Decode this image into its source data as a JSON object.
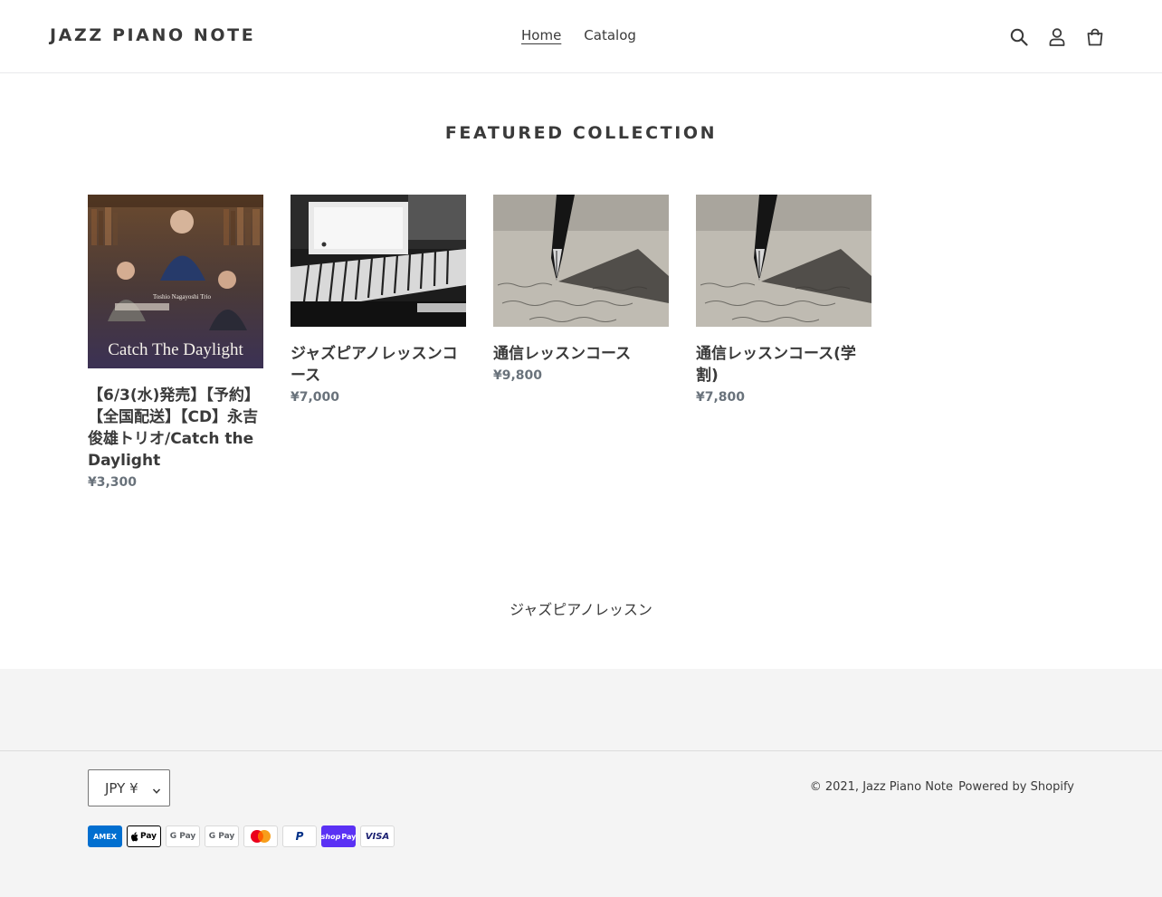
{
  "header": {
    "logo": "JAZZ PIANO NOTE",
    "nav": [
      {
        "label": "Home",
        "active": true
      },
      {
        "label": "Catalog",
        "active": false
      }
    ],
    "icons": [
      "search-icon",
      "account-icon",
      "cart-icon"
    ]
  },
  "featured": {
    "title": "FEATURED COLLECTION",
    "products": [
      {
        "title": "【6/3(水)発売】【予約】【全国配送】【CD】永吉俊雄トリオ/Catch the Daylight",
        "price": "¥3,300",
        "image_caption": "Catch The Daylight",
        "image_subcaption": "Toshio Nagayoshi Trio"
      },
      {
        "title": "ジャズピアノレッスンコース",
        "price": "¥7,000"
      },
      {
        "title": "通信レッスンコース",
        "price": "¥9,800"
      },
      {
        "title": "通信レッスンコース(学割)",
        "price": "¥7,800"
      }
    ]
  },
  "rich_text": "ジャズピアノレッスン",
  "footer": {
    "currency": "JPY ¥",
    "copyright_prefix": "© 2021,",
    "shop_name": "Jazz Piano Note",
    "powered_by": "Powered by Shopify",
    "payment_methods": [
      {
        "name": "AMEX",
        "bg": "#016fd0",
        "fg": "#ffffff"
      },
      {
        "name": "Pay",
        "bg": "#ffffff",
        "fg": "#000000"
      },
      {
        "name": "G Pay",
        "bg": "#ffffff",
        "fg": "#5f6368"
      },
      {
        "name": "G Pay",
        "bg": "#ffffff",
        "fg": "#5f6368"
      },
      {
        "name": "",
        "bg": "#ffffff",
        "fg": "#000000"
      },
      {
        "name": "P",
        "bg": "#ffffff",
        "fg": "#003087"
      },
      {
        "name": "Pay",
        "bg": "#5a31f4",
        "fg": "#ffffff"
      },
      {
        "name": "VISA",
        "bg": "#ffffff",
        "fg": "#1a1f71"
      }
    ]
  }
}
